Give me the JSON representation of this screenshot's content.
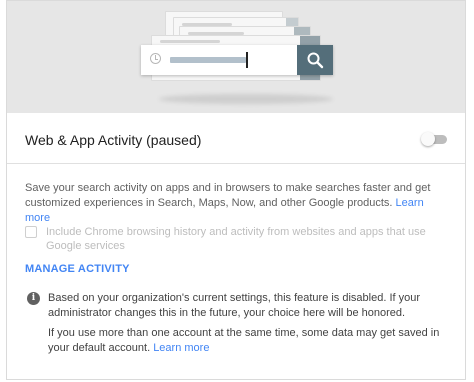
{
  "header": {
    "illustration": "browser-search-history-illustration"
  },
  "setting": {
    "title": "Web & App Activity (paused)",
    "toggle_state": "off"
  },
  "description": {
    "text": "Save your search activity on apps and in browsers to make searches faster and get customized experiences in Search, Maps, Now, and other Google products.",
    "learn_more": "Learn more"
  },
  "chrome_option": {
    "label": "Include Chrome browsing history and activity from websites and apps that use Google services",
    "checked": false,
    "disabled": true
  },
  "manage_activity": {
    "label": "MANAGE ACTIVITY"
  },
  "notice": {
    "icon": "info-icon",
    "icon_glyph": "i",
    "text": "Based on your organization's current settings, this feature is disabled. If your administrator changes this in the future, your choice here will be honored.",
    "multi_account_text": "If you use more than one account at the same time, some data may get saved in your default account.",
    "learn_more": "Learn more"
  },
  "colors": {
    "link": "#4285f4",
    "search_button": "#546e7a",
    "hero_background": "#e6e6e6"
  }
}
